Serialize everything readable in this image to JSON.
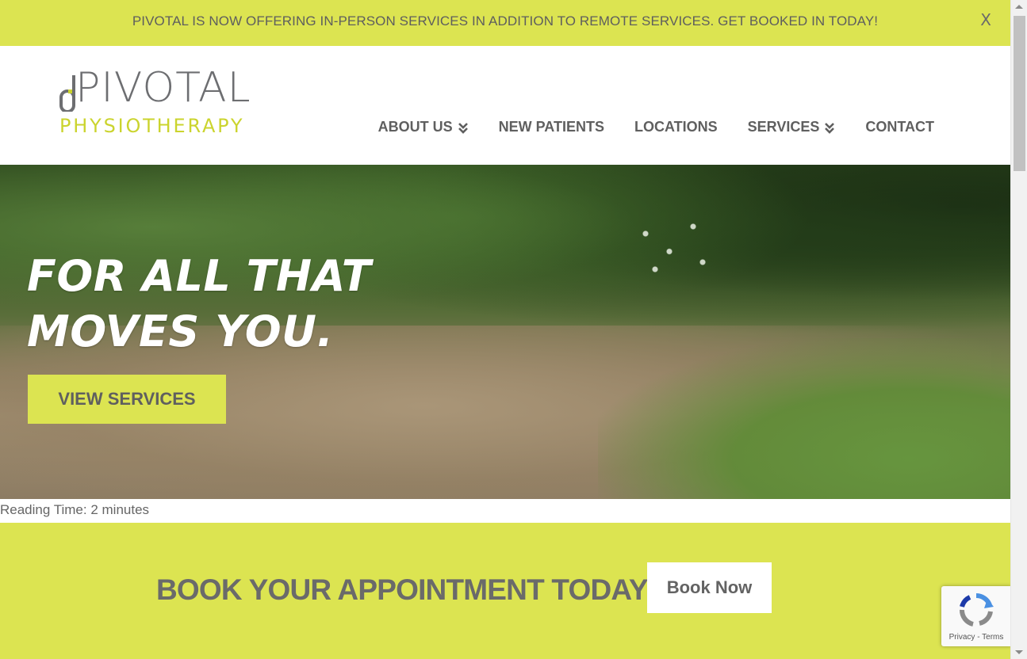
{
  "announcement": {
    "message": "PIVOTAL IS NOW OFFERING IN-PERSON SERVICES IN ADDITION TO REMOTE SERVICES. GET BOOKED IN TODAY!",
    "close_label": "X"
  },
  "logo": {
    "name": "PIVOTAL",
    "subtitle": "PHYSIOTHERAPY"
  },
  "nav": {
    "items": [
      {
        "label": "ABOUT US",
        "has_dropdown": true
      },
      {
        "label": "NEW PATIENTS",
        "has_dropdown": false
      },
      {
        "label": "LOCATIONS",
        "has_dropdown": false
      },
      {
        "label": "SERVICES",
        "has_dropdown": true
      },
      {
        "label": "CONTACT",
        "has_dropdown": false
      }
    ]
  },
  "hero": {
    "headline_line1": "FOR ALL THAT",
    "headline_line2": "MOVES YOU.",
    "cta_label": "VIEW SERVICES"
  },
  "reading_time": "Reading Time: 2 minutes",
  "booking": {
    "title": "BOOK YOUR APPOINTMENT TODAY!",
    "button_label": "Book Now"
  },
  "recaptcha": {
    "privacy_label": "Privacy",
    "separator": " - ",
    "terms_label": "Terms"
  },
  "colors": {
    "accent": "#dce451",
    "logo_green": "#cbd42e",
    "text_gray": "#5f5f5f"
  }
}
